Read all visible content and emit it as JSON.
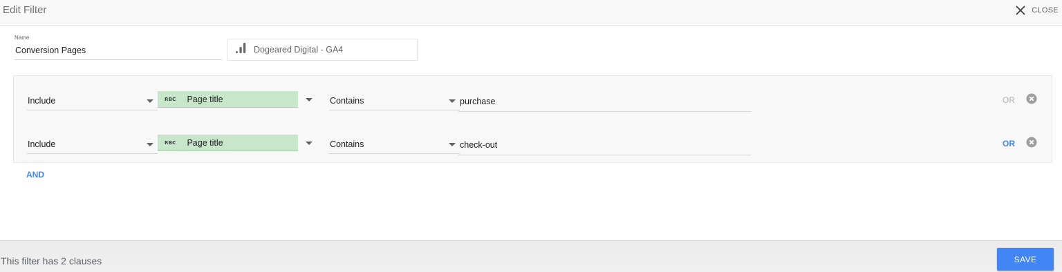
{
  "header": {
    "title": "Edit Filter",
    "close_label": "CLOSE"
  },
  "name_field": {
    "caption": "Name",
    "value": "Conversion Pages"
  },
  "data_source": {
    "icon": "bar-chart-icon",
    "label": "Dogeared Digital - GA4"
  },
  "clauses": [
    {
      "mode": "Include",
      "field_type_icon": "RBC",
      "field": "Page title",
      "operator": "Contains",
      "value": "purchase",
      "or_label": "OR",
      "or_enabled": false
    },
    {
      "mode": "Include",
      "field_type_icon": "RBC",
      "field": "Page title",
      "operator": "Contains",
      "value": "check-out",
      "or_label": "OR",
      "or_enabled": true
    }
  ],
  "and_label": "AND",
  "footer": {
    "status": "This filter has 2 clauses",
    "save_label": "SAVE"
  },
  "colors": {
    "accent": "#4285f4",
    "field_chip": "#c8e6c9",
    "header_bg": "#f8f8f8"
  }
}
